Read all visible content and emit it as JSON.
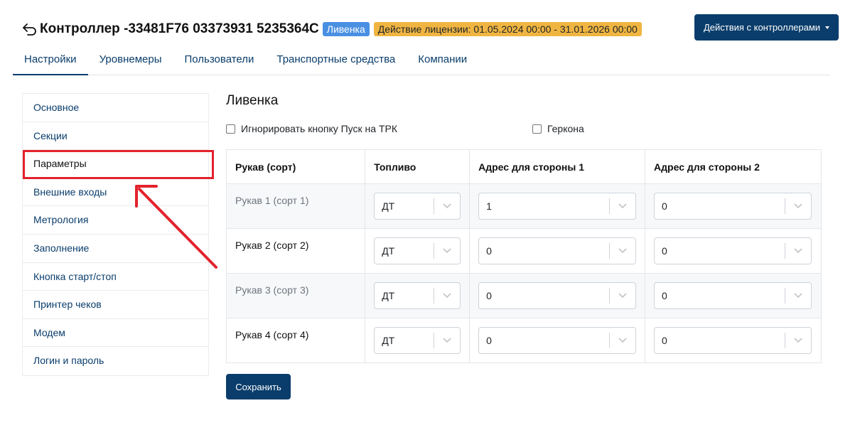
{
  "header": {
    "title": "Контроллер -33481F76 03373931 5235364C",
    "location_badge": "Ливенка",
    "license_badge": "Действие лицензии: 01.05.2024 00:00 - 31.01.2026 00:00",
    "actions_button": "Действия с контроллерами"
  },
  "tabs": [
    {
      "label": "Настройки",
      "active": true
    },
    {
      "label": "Уровнемеры",
      "active": false
    },
    {
      "label": "Пользователи",
      "active": false
    },
    {
      "label": "Транспортные средства",
      "active": false
    },
    {
      "label": "Компании",
      "active": false
    }
  ],
  "sidebar": {
    "items": [
      {
        "label": "Основное"
      },
      {
        "label": "Секции"
      },
      {
        "label": "Параметры",
        "selected": true
      },
      {
        "label": "Внешние входы"
      },
      {
        "label": "Метрология"
      },
      {
        "label": "Заполнение"
      },
      {
        "label": "Кнопка старт/стоп"
      },
      {
        "label": "Принтер чеков"
      },
      {
        "label": "Модем"
      },
      {
        "label": "Логин и пароль"
      }
    ]
  },
  "main": {
    "title": "Ливенка",
    "checkboxes": {
      "ignore_start": {
        "label": "Игнорировать кнопку Пуск на ТРК",
        "checked": false
      },
      "reed": {
        "label": "Геркона",
        "checked": false
      }
    },
    "table": {
      "headers": [
        "Рукав (сорт)",
        "Топливо",
        "Адрес для стороны 1",
        "Адрес для стороны 2"
      ],
      "rows": [
        {
          "hose": "Рукав 1 (сорт 1)",
          "fuel": "ДТ",
          "side1": "1",
          "side2": "0"
        },
        {
          "hose": "Рукав 2 (сорт 2)",
          "fuel": "ДТ",
          "side1": "0",
          "side2": "0"
        },
        {
          "hose": "Рукав 3 (сорт 3)",
          "fuel": "ДТ",
          "side1": "0",
          "side2": "0"
        },
        {
          "hose": "Рукав 4 (сорт 4)",
          "fuel": "ДТ",
          "side1": "0",
          "side2": "0"
        }
      ]
    },
    "save_button": "Сохранить"
  },
  "colors": {
    "primary": "#0a3d6b",
    "badge_blue": "#4a90e2",
    "badge_yellow": "#f0b541",
    "annotation_red": "#e3222c"
  },
  "icons": {
    "back": "back-arrow-icon",
    "dropdown": "chevron-down-icon",
    "annotation": "red-arrow-annotation"
  }
}
